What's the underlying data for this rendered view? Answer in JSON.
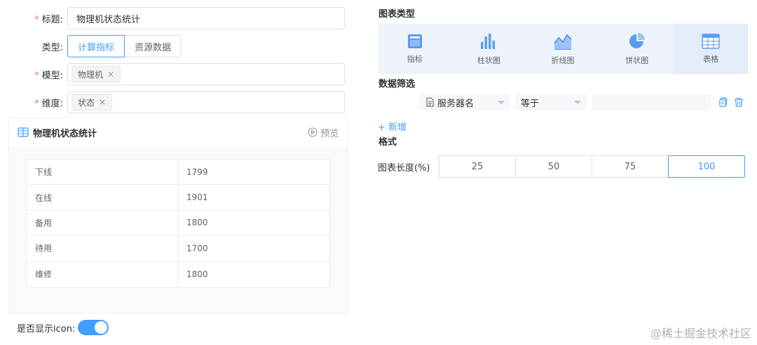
{
  "form": {
    "title_label": "标题:",
    "title_value": "物理机状态统计",
    "type_label": "类型:",
    "type_options": [
      "计算指标",
      "资源数据"
    ],
    "model_label": "模型:",
    "model_tag": "物理机",
    "dimension_label": "维度:",
    "dimension_tag": "状态",
    "tag_close": "×",
    "required_mark": "*"
  },
  "preview": {
    "title": "物理机状态统计",
    "preview_link": "预览",
    "rows": [
      {
        "name": "下线",
        "value": "1799"
      },
      {
        "name": "在线",
        "value": "1901"
      },
      {
        "name": "备用",
        "value": "1800"
      },
      {
        "name": "待用",
        "value": "1700"
      },
      {
        "name": "维修",
        "value": "1800"
      }
    ]
  },
  "switch": {
    "label": "是否显示icon:",
    "on": true
  },
  "chart_type": {
    "title": "图表类型",
    "items": [
      {
        "label": "指标",
        "icon": "metric-icon"
      },
      {
        "label": "柱状图",
        "icon": "bar-chart-icon"
      },
      {
        "label": "折线图",
        "icon": "line-chart-icon"
      },
      {
        "label": "饼状图",
        "icon": "pie-chart-icon"
      },
      {
        "label": "表格",
        "icon": "table-icon"
      }
    ],
    "selected": "表格"
  },
  "filter": {
    "title": "数据筛选",
    "field": "服务器名",
    "operator": "等于",
    "value": "",
    "add_label": "+ 新增"
  },
  "format": {
    "title": "格式",
    "length_label": "图表长度(%)",
    "options": [
      "25",
      "50",
      "75",
      "100"
    ],
    "selected": "100"
  },
  "watermark": "@稀土掘金技术社区",
  "colors": {
    "primary": "#409eff",
    "required": "#f56c6c",
    "chart_type_bg": "#eef3fb"
  }
}
